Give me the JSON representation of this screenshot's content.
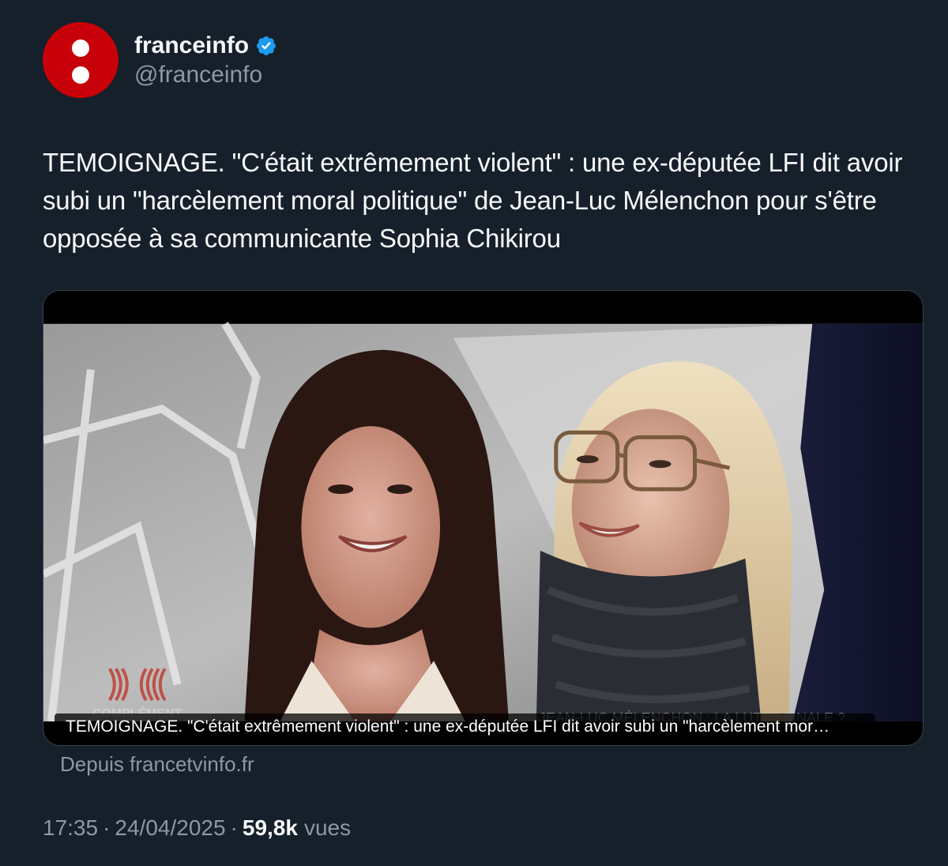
{
  "author": {
    "display_name": "franceinfo",
    "handle": "@franceinfo",
    "verified": true,
    "avatar_color": "#c8000a",
    "badge_color": "#1d9bf0"
  },
  "tweet": {
    "text": "TEMOIGNAGE. \"C'était extrêmement violent\" : une ex-députée LFI dit avoir subi un \"harcèlement moral politique\" de Jean-Luc Mélenchon pour s'être opposée à sa communicante Sophia Chikirou"
  },
  "card": {
    "caption": "TEMOIGNAGE. \"C'était extrêmement violent\" : une ex-députée LFI dit avoir subi un \"harcèlement mor…",
    "source": "Depuis francetvinfo.fr",
    "overlay_logo_text": "COMPLÉMENT",
    "overlay_lower_third": "JEAN-LUC MÉLENCHON : LA LUTTE FINALE ?"
  },
  "meta": {
    "time": "17:35",
    "date": "24/04/2025",
    "separator": "·",
    "views_count": "59,8k",
    "views_label": "vues"
  },
  "colors": {
    "background": "#15202b",
    "primary_text": "#f7f9f9",
    "secondary_text": "#8b98a5",
    "border": "#38444d"
  }
}
